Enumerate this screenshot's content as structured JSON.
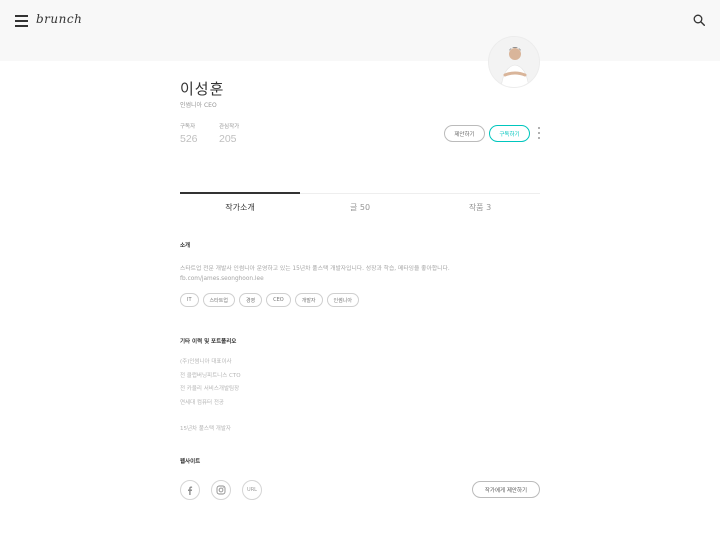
{
  "header": {
    "logo": "brunch",
    "menu_icon": "hamburger-menu-icon",
    "search_icon": "search-icon"
  },
  "profile": {
    "avatar_icon": "author-avatar",
    "name": "이성훈",
    "job": "인썸니아 CEO",
    "stats": [
      {
        "label": "구독자",
        "value": "526"
      },
      {
        "label": "관심작가",
        "value": "205"
      }
    ],
    "buttons": {
      "propose": "제안하기",
      "subscribe": "구독하기"
    },
    "more_icon": "more-vertical-icon",
    "accent_color": "#00c6be"
  },
  "tabs": [
    {
      "label": "작가소개",
      "active": true
    },
    {
      "label": "글 50",
      "active": false
    },
    {
      "label": "작품 3",
      "active": false
    }
  ],
  "intro": {
    "title": "소개",
    "text": "스타트업 전문 개발사 인썸니아 운영하고 있는 15년차 풀스택 개발자입니다. 성장과 학습, 메타잉을 좋아합니다.",
    "link": "fb.com/james.seonghoon.lee",
    "tags": [
      "IT",
      "스타트업",
      "경영",
      "CEO",
      "개발자",
      "인썸니아"
    ]
  },
  "history": {
    "title": "기타 이력 및 포트폴리오",
    "lines": [
      "(주)인썸니아 대표이사",
      "전 클럽버닝피트니스 CTO",
      "전 카울리 서비스개발팀장",
      "연세대 컴퓨터 전공"
    ],
    "extra": "15년차 풀스택 개발자"
  },
  "website": {
    "title": "웹사이트",
    "icons": [
      "facebook-icon",
      "instagram-icon"
    ],
    "url_label": "URL",
    "propose_author": "작가에게 제안하기"
  }
}
